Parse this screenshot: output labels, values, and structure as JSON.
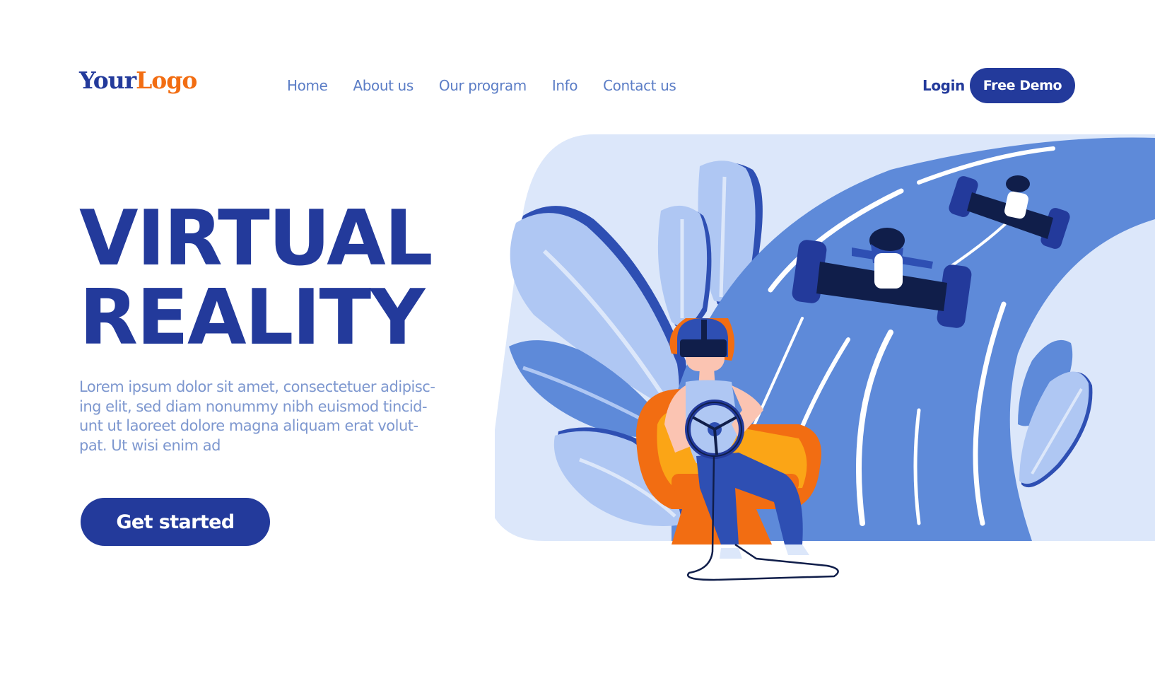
{
  "header": {
    "logo": {
      "part1": "Your",
      "part2": "Logo"
    },
    "nav": [
      {
        "label": "Home"
      },
      {
        "label": "About us"
      },
      {
        "label": "Our program"
      },
      {
        "label": "Info"
      },
      {
        "label": "Contact us"
      }
    ],
    "login_label": "Login",
    "demo_label": "Free Demo"
  },
  "hero": {
    "title_lines": [
      "VIRTUAL",
      "REALITY"
    ],
    "body_lines": [
      "Lorem ipsum dolor sit amet, consectetuer adipisc-",
      "ing elit, sed diam nonummy nibh euismod tincid-",
      "unt ut laoreet dolore magna aliquam erat volut-",
      "pat. Ut wisi enim ad"
    ],
    "cta_label": "Get started"
  },
  "illustration": {
    "subject": "person in VR headset sitting in armchair holding steering wheel, race track with two formula cars",
    "colors": {
      "primary": "#233a9b",
      "accent": "#f26d12",
      "yellow": "#fba516",
      "track": "#5e8ad9",
      "panel": "#dce7fa",
      "leaf_light": "#afc7f3",
      "leaf_mid": "#5e8ad9",
      "dark": "#101e4a",
      "skin": "#fbc4b2"
    }
  }
}
